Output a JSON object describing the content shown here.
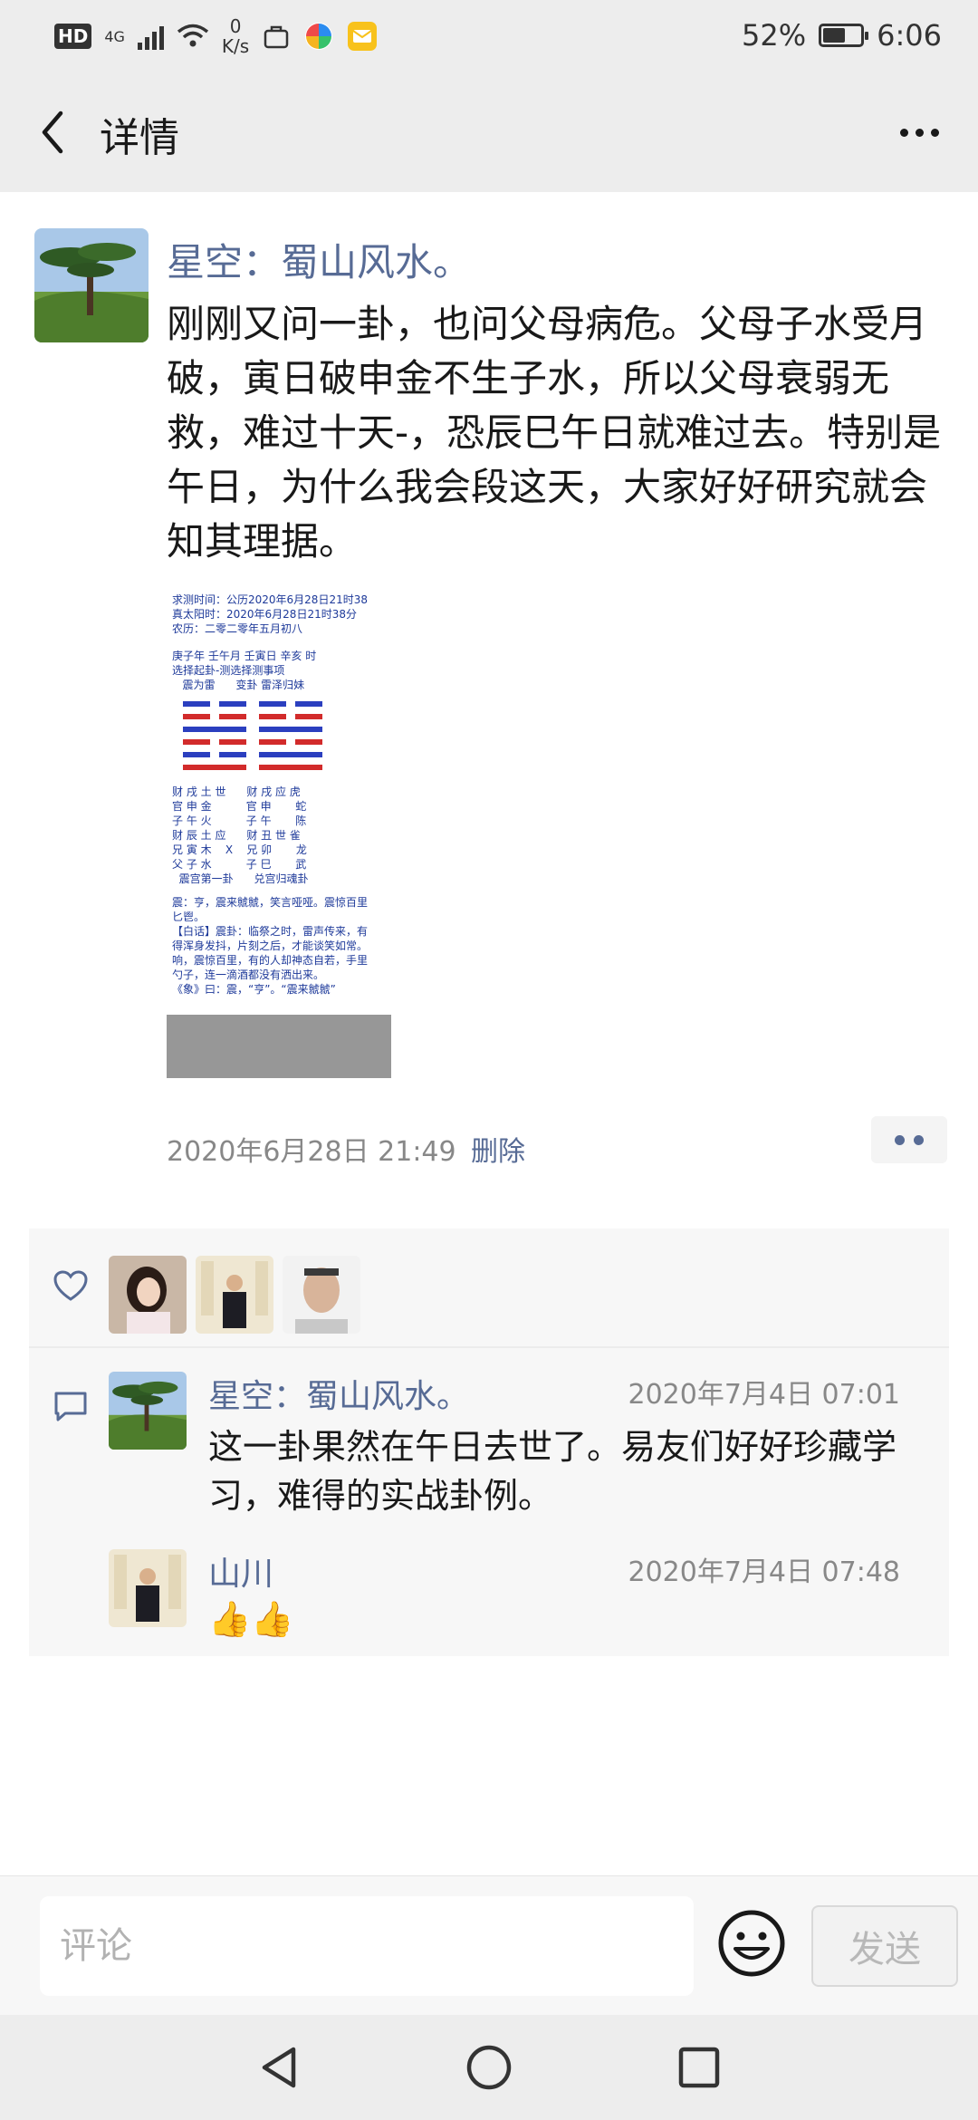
{
  "status_bar": {
    "hd": "HD",
    "network": "4G",
    "speed_value": "0",
    "speed_unit": "K/s",
    "battery": "52%",
    "time": "6:06"
  },
  "nav": {
    "title": "详情"
  },
  "post": {
    "author": "星空：蜀山风水。",
    "text": "刚刚又问一卦，也问父母病危。父母子水受月破，寅日破申金不生子水，所以父母衰弱无救，难过十天-，恐辰巳午日就难过去。特别是午日，为什么我会段这天，大家好好研究就会知其理据。",
    "timestamp": "2020年6月28日 21:49",
    "delete_label": "删除",
    "image": {
      "lines": [
        "求测时间：公历2020年6月28日21时38",
        "真太阳时：2020年6月28日21时38分",
        "农历：二零二零年五月初八",
        "",
        "庚子年 壬午月 壬寅日 辛亥 时",
        "选择起卦-测选择测事项",
        "   震为雷      变卦 雷泽归妹"
      ],
      "yao_lines": [
        "财 戌 土 世      财 戌 应 虎",
        "官 申 金          官 申       蛇",
        "子 午 火          子 午       陈",
        "财 辰 土 应      财 丑 世 雀",
        "兄 寅 木    X    兄 卯       龙",
        "父 子 水          子 巳       武",
        "  震宫第一卦      兑宫归魂卦"
      ],
      "notes": [
        "震：亨，震来虩虩，笑言哑哑。震惊百里",
        "匕鬯。",
        "【白话】震卦：临祭之时，雷声传来，有",
        "得浑身发抖，片刻之后，才能谈笑如常。",
        "响，震惊百里，有的人却神态自若，手里",
        "勺子，连一滴酒都没有洒出来。",
        "《象》曰：震，“亨”。“震来虩虩”"
      ]
    }
  },
  "comments": [
    {
      "name": "星空：蜀山风水。",
      "time": "2020年7月4日 07:01",
      "text": "这一卦果然在午日去世了。易友们好好珍藏学习，难得的实战卦例。"
    },
    {
      "name": "山川",
      "time": "2020年7月4日 07:48",
      "text": "👍👍"
    }
  ],
  "input": {
    "placeholder": "评论",
    "send_label": "发送"
  },
  "colors": {
    "link": "#576b95",
    "background": "#ededed"
  }
}
